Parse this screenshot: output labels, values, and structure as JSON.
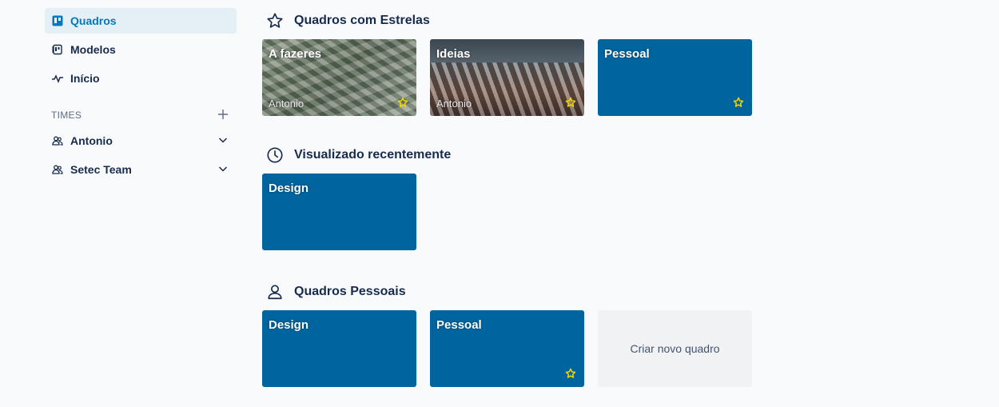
{
  "sidebar": {
    "items": [
      {
        "label": "Quadros",
        "icon": "board-icon",
        "active": true
      },
      {
        "label": "Modelos",
        "icon": "template-icon"
      },
      {
        "label": "Início",
        "icon": "activity-icon"
      }
    ],
    "teams_label": "TIMES",
    "teams": [
      {
        "label": "Antonio",
        "icon": "team-icon"
      },
      {
        "label": "Setec Team",
        "icon": "team-icon"
      }
    ]
  },
  "sections": {
    "starred": {
      "title": "Quadros com Estrelas",
      "icon": "star-outline-icon",
      "boards": [
        {
          "title": "A fazeres",
          "owner": "Antonio",
          "starred": true,
          "background": "money-photo"
        },
        {
          "title": "Ideias",
          "owner": "Antonio",
          "starred": true,
          "background": "mountain-photo"
        },
        {
          "title": "Pessoal",
          "starred": true,
          "background": "#00659f"
        }
      ]
    },
    "recent": {
      "title": "Visualizado recentemente",
      "icon": "clock-icon",
      "boards": [
        {
          "title": "Design",
          "background": "#00659f"
        }
      ]
    },
    "personal": {
      "title": "Quadros Pessoais",
      "icon": "person-icon",
      "boards": [
        {
          "title": "Design",
          "background": "#00659f"
        },
        {
          "title": "Pessoal",
          "starred": true,
          "background": "#00659f"
        }
      ],
      "create_label": "Criar novo quadro"
    }
  },
  "colors": {
    "accent": "#0079bf",
    "board_blue": "#00659f",
    "star": "#f2d600"
  }
}
